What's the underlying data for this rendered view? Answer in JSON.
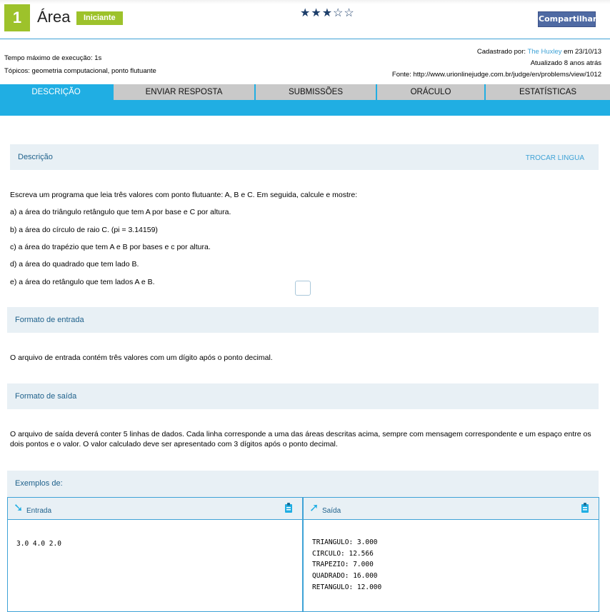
{
  "problem": {
    "number": "1",
    "title": "Área",
    "level": "Iniciante",
    "stars": "★★★☆☆",
    "share": "Compartilhar"
  },
  "meta": {
    "time_limit": "Tempo máximo de execução: 1s",
    "topics": "Tópicos: geometria computacional, ponto flutuante",
    "registered_prefix": "Cadastrado por:",
    "registered_by": "The Huxley",
    "registered_date": "em 23/10/13",
    "updated": "Atualizado 8 anos atrás",
    "source": "Fonte: http://www.urionlinejudge.com.br/judge/en/problems/view/1012"
  },
  "tabs": [
    "DESCRIÇÃO",
    "ENVIAR RESPOSTA",
    "SUBMISSÕES",
    "ORÁCULO",
    "ESTATÍSTICAS"
  ],
  "description": {
    "heading": "Descrição",
    "switch_language": "TROCAR LINGUA",
    "intro": "Escreva um programa que leia três valores com ponto flutuante: A, B e C. Em seguida, calcule e mostre:",
    "items": [
      "a) a área do triângulo retângulo que tem A por base e C por altura.",
      "b) a área do círculo de raio C. (pi = 3.14159)",
      "c) a área do trapézio que tem A e B por bases e c por altura.",
      "d) a área do quadrado que tem lado B.",
      "e) a área do retângulo que tem lados A e B."
    ]
  },
  "input_format": {
    "heading": "Formato de entrada",
    "text": "O arquivo de entrada contém três valores com um dígito após o ponto decimal."
  },
  "output_format": {
    "heading": "Formato de saída",
    "text": "O arquivo de saída deverá conter 5 linhas de dados. Cada linha corresponde a uma das áreas descritas acima, sempre com mensagem correspondente e um espaço entre os dois pontos e o valor. O valor calculado deve ser apresentado com 3 dígitos após o ponto decimal."
  },
  "examples": {
    "heading": "Exemplos de:",
    "input_label": "Entrada",
    "output_label": "Saída",
    "input": "3.0 4.0 2.0",
    "output": "TRIANGULO: 3.000\nCIRCULO: 12.566\nTRAPEZIO: 7.000\nQUADRADO: 16.000\nRETANGULO: 12.000"
  },
  "colors": {
    "accent": "#20aee3",
    "level": "#9dc22b",
    "section_bg": "#e8f0f5",
    "share": "#4f6aa3"
  }
}
